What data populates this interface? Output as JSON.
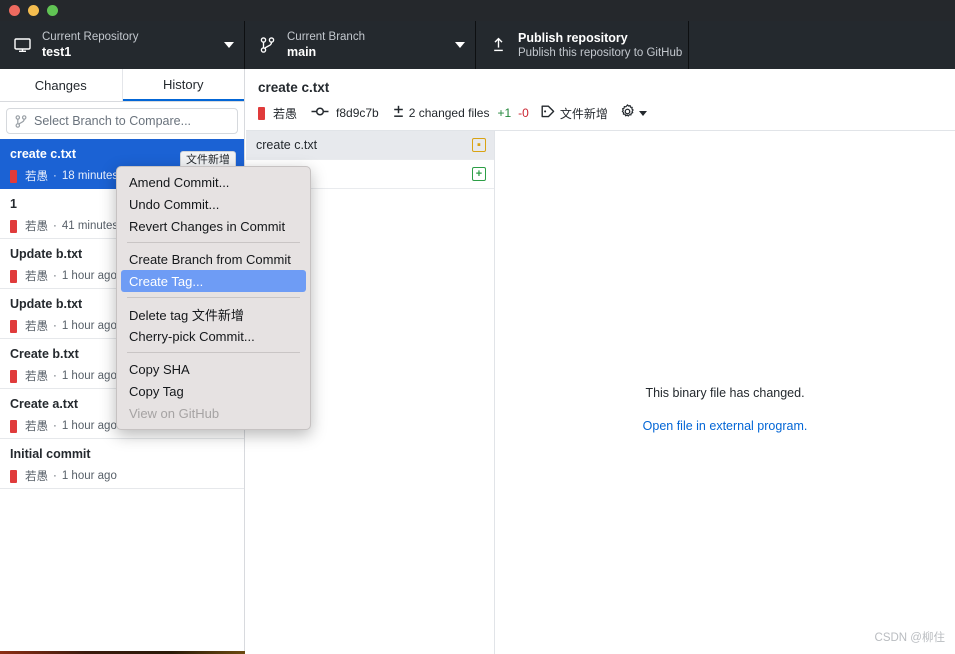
{
  "window": {
    "traffic_lights": [
      "close",
      "minimize",
      "maximize"
    ]
  },
  "toolbar": {
    "repository": {
      "label": "Current Repository",
      "value": "test1",
      "icon": "desktop-icon"
    },
    "branch": {
      "label": "Current Branch",
      "value": "main",
      "icon": "branch-icon"
    },
    "publish": {
      "title": "Publish repository",
      "subtitle": "Publish this repository to GitHub",
      "icon": "upload-icon"
    }
  },
  "sidebar": {
    "tabs": [
      {
        "label": "Changes",
        "active": false
      },
      {
        "label": "History",
        "active": true
      }
    ],
    "compare": {
      "placeholder": "Select Branch to Compare...",
      "icon": "branch-icon"
    },
    "commits": [
      {
        "title": "create c.txt",
        "author": "若愚",
        "time": "18 minutes",
        "tag": "文件新增",
        "selected": true
      },
      {
        "title": "1",
        "author": "若愚",
        "time": "41 minutes",
        "tag": "",
        "selected": false
      },
      {
        "title": "Update b.txt",
        "author": "若愚",
        "time": "1 hour ago",
        "tag": "",
        "selected": false
      },
      {
        "title": "Update b.txt",
        "author": "若愚",
        "time": "1 hour ago",
        "tag": "",
        "selected": false
      },
      {
        "title": "Create b.txt",
        "author": "若愚",
        "time": "1 hour ago",
        "tag": "",
        "selected": false
      },
      {
        "title": "Create a.txt",
        "author": "若愚",
        "time": "1 hour ago",
        "tag": "",
        "selected": false
      },
      {
        "title": "Initial commit",
        "author": "若愚",
        "time": "1 hour ago",
        "tag": "",
        "selected": false
      }
    ],
    "separator_dot": "·"
  },
  "commit_detail": {
    "title": "create c.txt",
    "author": "若愚",
    "sha": "f8d9c7b",
    "changed_files": "2 changed files",
    "additions": "+1",
    "deletions": "-0",
    "tag": "文件新增",
    "files": [
      {
        "name": "create c.txt",
        "status": "modified",
        "status_glyph": "▪",
        "selected": true
      },
      {
        "name": "",
        "status": "added",
        "status_glyph": "+",
        "selected": false
      }
    ],
    "diff": {
      "binary_message": "This binary file has changed.",
      "open_external_label": "Open file in external program."
    }
  },
  "context_menu": {
    "items": [
      {
        "label": "Amend Commit...",
        "type": "item",
        "state": "normal"
      },
      {
        "label": "Undo Commit...",
        "type": "item",
        "state": "normal"
      },
      {
        "label": "Revert Changes in Commit",
        "type": "item",
        "state": "normal"
      },
      {
        "label": "",
        "type": "separator",
        "state": "normal"
      },
      {
        "label": "Create Branch from Commit",
        "type": "item",
        "state": "normal"
      },
      {
        "label": "Create Tag...",
        "type": "item",
        "state": "highlight"
      },
      {
        "label": "",
        "type": "separator",
        "state": "normal"
      },
      {
        "label": "Delete tag 文件新增",
        "type": "item",
        "state": "normal"
      },
      {
        "label": "Cherry-pick Commit...",
        "type": "item",
        "state": "normal"
      },
      {
        "label": "",
        "type": "separator",
        "state": "normal"
      },
      {
        "label": "Copy SHA",
        "type": "item",
        "state": "normal"
      },
      {
        "label": "Copy Tag",
        "type": "item",
        "state": "normal"
      },
      {
        "label": "View on GitHub",
        "type": "item",
        "state": "disabled"
      }
    ]
  },
  "watermark": "CSDN @柳住",
  "colors": {
    "toolbar_bg": "#24292e",
    "titlebar_bg": "#25282c",
    "selection_blue": "#1b62d4",
    "menu_highlight": "#6e9cf5",
    "link_blue": "#0366d6",
    "add_green": "#22863a",
    "del_red": "#cb2431",
    "tab_active_underline": "#0366d6"
  }
}
